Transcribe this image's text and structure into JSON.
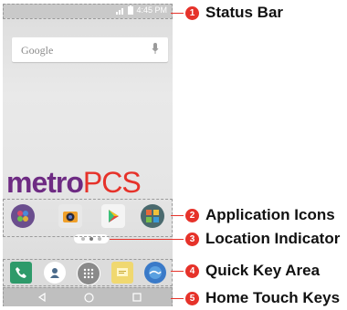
{
  "status_bar": {
    "time": "4:45 PM"
  },
  "search": {
    "placeholder": "Google"
  },
  "brand": {
    "part1": "metro",
    "part2": "PCS"
  },
  "apps": [
    "app-1",
    "camera",
    "play-store",
    "app-4"
  ],
  "quick_keys": [
    "phone",
    "contacts",
    "apps",
    "messages",
    "browser"
  ],
  "home_keys": [
    "back",
    "home",
    "recent"
  ],
  "callouts": [
    {
      "number": "1",
      "label": "Status Bar"
    },
    {
      "number": "2",
      "label": "Application Icons"
    },
    {
      "number": "3",
      "label": "Location Indicator"
    },
    {
      "number": "4",
      "label": "Quick Key Area"
    },
    {
      "number": "5",
      "label": "Home Touch Keys"
    }
  ],
  "colors": {
    "callout": "#e6322a",
    "brand_purple": "#6e2b83",
    "brand_red": "#e6322a"
  }
}
